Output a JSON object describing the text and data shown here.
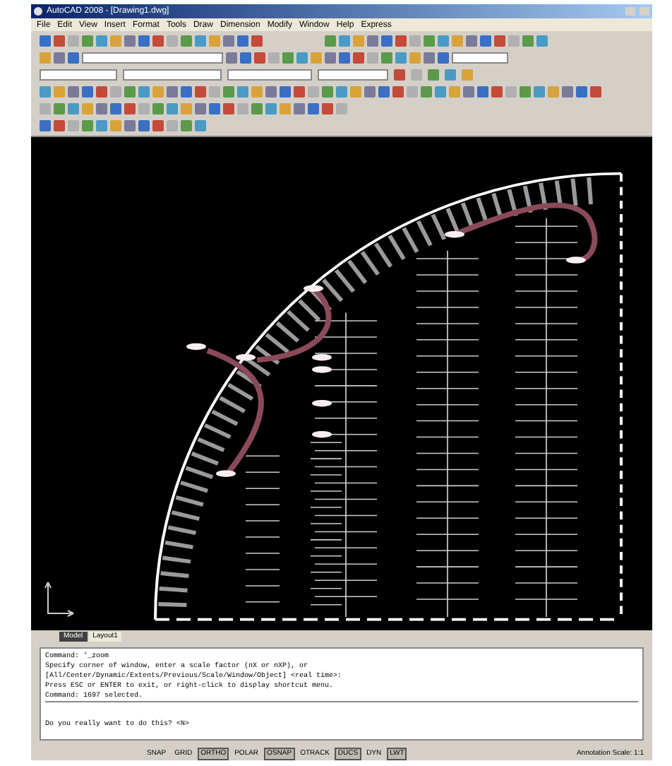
{
  "window": {
    "title": "AutoCAD 2008 - [Drawing1.dwg]"
  },
  "menu": [
    "File",
    "Edit",
    "View",
    "Insert",
    "Format",
    "Tools",
    "Draw",
    "Dimension",
    "Modify",
    "Window",
    "Help",
    "Express"
  ],
  "layout_tabs": [
    {
      "label": "Model",
      "selected": true
    },
    {
      "label": "Layout1",
      "selected": false
    }
  ],
  "command_lines": [
    "Command: '_zoom",
    "Specify corner of window, enter a scale factor (nX or nXP), or",
    "[All/Center/Dynamic/Extents/Previous/Scale/Window/Object] <real time>:",
    "Press ESC or ENTER to exit, or right-click to display shortcut menu.",
    "Command: 1697 selected."
  ],
  "command_prompt": "Do you really want to do this? <N>",
  "status_bar": {
    "toggles": [
      {
        "label": "SNAP",
        "on": false
      },
      {
        "label": "GRID",
        "on": false
      },
      {
        "label": "ORTHO",
        "on": true
      },
      {
        "label": "POLAR",
        "on": false
      },
      {
        "label": "OSNAP",
        "on": true
      },
      {
        "label": "OTRACK",
        "on": false
      },
      {
        "label": "DUCS",
        "on": true
      },
      {
        "label": "DYN",
        "on": false
      },
      {
        "label": "LWT",
        "on": true
      }
    ],
    "annotation_scale": "Annotation Scale: 1:1"
  }
}
